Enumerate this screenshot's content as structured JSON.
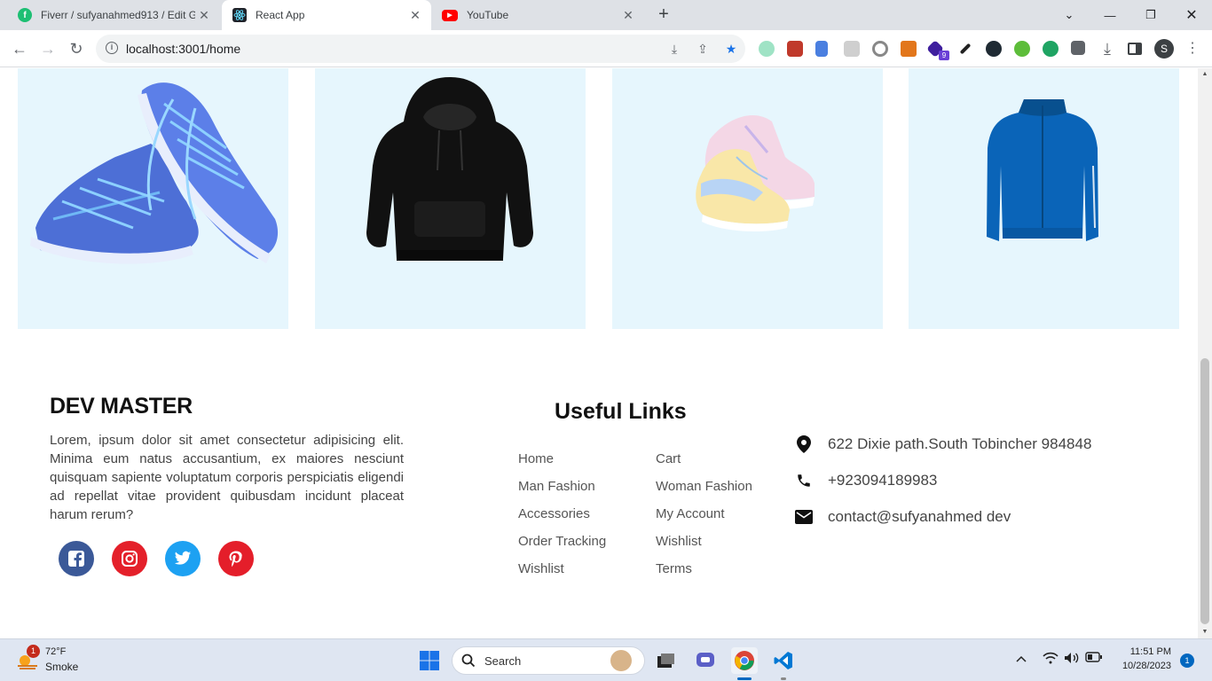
{
  "browser": {
    "tabs": [
      {
        "title": "Fiverr / sufyanahmed913 / Edit G",
        "active": false,
        "favicon": "fiverr-icon"
      },
      {
        "title": "React App",
        "active": true,
        "favicon": "react-icon"
      },
      {
        "title": "YouTube",
        "active": false,
        "favicon": "youtube-icon"
      }
    ],
    "url": "localhost:3001/home",
    "profile_initial": "S",
    "extension_badge": "9"
  },
  "products": [
    {
      "name": "blue-sneakers"
    },
    {
      "name": "black-hoodie"
    },
    {
      "name": "pastel-sneakers"
    },
    {
      "name": "blue-track-jacket"
    }
  ],
  "footer": {
    "brand": "DEV MASTER",
    "about": "Lorem, ipsum dolor sit amet consectetur adipisicing elit. Minima eum natus accusantium, ex maiores nesciunt quisquam sapiente voluptatum corporis perspiciatis eligendi ad repellat vitae provident quibusdam incidunt placeat harum rerum?",
    "social": [
      {
        "name": "facebook-icon",
        "color": "#3b5998"
      },
      {
        "name": "instagram-icon",
        "color": "#e4202a"
      },
      {
        "name": "twitter-icon",
        "color": "#1da1f2"
      },
      {
        "name": "pinterest-icon",
        "color": "#e41e2a"
      }
    ],
    "useful_links_title": "Useful Links",
    "links_col1": [
      "Home",
      "Man Fashion",
      "Accessories",
      "Order Tracking",
      "Wishlist"
    ],
    "links_col2": [
      "Cart",
      "Woman Fashion",
      "My Account",
      "Wishlist",
      "Terms"
    ],
    "contact": {
      "address": "622 Dixie path.South Tobincher 984848",
      "phone": "+923094189983",
      "email": "contact@sufyanahmed dev"
    }
  },
  "taskbar": {
    "weather_badge": "1",
    "temperature": "72°F",
    "condition": "Smoke",
    "search_label": "Search",
    "time": "11:51 PM",
    "date": "10/28/2023",
    "notification_count": "1"
  }
}
